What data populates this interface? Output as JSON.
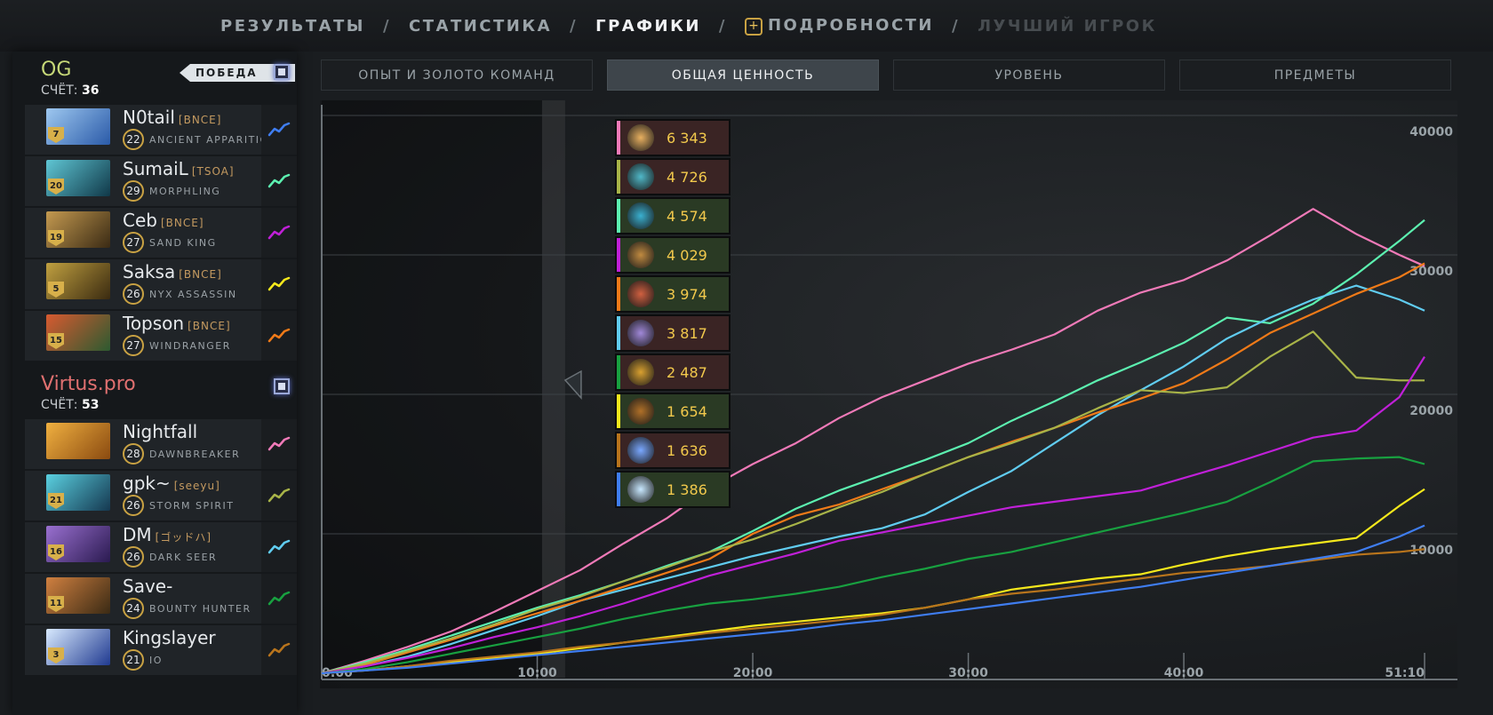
{
  "nav": {
    "tabs": [
      "РЕЗУЛЬТАТЫ",
      "СТАТИСТИКА",
      "ГРАФИКИ",
      "ПОДРОБНОСТИ",
      "ЛУЧШИЙ ИГРОК"
    ],
    "active_tab": "ГРАФИКИ",
    "separator": "/"
  },
  "teams": [
    {
      "name": "OG",
      "name_color": "#c6d878",
      "score_label": "СЧЁТ:",
      "score": "36",
      "badge": "ПОБЕДА",
      "players": [
        {
          "name": "N0tail",
          "tag": "[BNCE]",
          "level": "22",
          "hero": "ANCIENT APPARITION",
          "portrait_level": "7",
          "trend_color": "#3f7df0",
          "portrait_colors": [
            "#9ec8f0",
            "#2a5aa8"
          ]
        },
        {
          "name": "SumaiL",
          "tag": "[TSOA]",
          "level": "29",
          "hero": "MORPHLING",
          "portrait_level": "20",
          "trend_color": "#5cf0b0",
          "portrait_colors": [
            "#5fc6d4",
            "#103848"
          ]
        },
        {
          "name": "Ceb",
          "tag": "[BNCE]",
          "level": "27",
          "hero": "SAND KING",
          "portrait_level": "19",
          "trend_color": "#c020d8",
          "portrait_colors": [
            "#c49a50",
            "#3a2a14"
          ]
        },
        {
          "name": "Saksa",
          "tag": "[BNCE]",
          "level": "26",
          "hero": "NYX ASSASSIN",
          "portrait_level": "5",
          "trend_color": "#f4e81c",
          "portrait_colors": [
            "#c0a040",
            "#3a2a10"
          ]
        },
        {
          "name": "Topson",
          "tag": "[BNCE]",
          "level": "27",
          "hero": "WINDRANGER",
          "portrait_level": "15",
          "trend_color": "#f07a18",
          "portrait_colors": [
            "#d85a30",
            "#2c5a30"
          ]
        }
      ]
    },
    {
      "name": "Virtus.pro",
      "name_color": "#e07070",
      "score_label": "СЧЁТ:",
      "score": "53",
      "players": [
        {
          "name": "Nightfall",
          "tag": "",
          "level": "28",
          "hero": "DAWNBREAKER",
          "portrait_level": "",
          "trend_color": "#f07ab8",
          "portrait_colors": [
            "#f0b040",
            "#8a4a10"
          ]
        },
        {
          "name": "gpk~",
          "tag": "[seeyu]",
          "level": "26",
          "hero": "STORM SPIRIT",
          "portrait_level": "21",
          "trend_color": "#a8b448",
          "portrait_colors": [
            "#5ad0e0",
            "#153850"
          ]
        },
        {
          "name": "DM",
          "tag": "[ゴッドハ]",
          "level": "26",
          "hero": "DARK SEER",
          "portrait_level": "16",
          "trend_color": "#60ccf0",
          "portrait_colors": [
            "#9a70d0",
            "#2a1a50"
          ]
        },
        {
          "name": "Save-",
          "tag": "",
          "level": "24",
          "hero": "BOUNTY HUNTER",
          "portrait_level": "11",
          "trend_color": "#18a040",
          "portrait_colors": [
            "#d08040",
            "#3a2a14"
          ]
        },
        {
          "name": "Kingslayer",
          "tag": "",
          "level": "21",
          "hero": "IO",
          "portrait_level": "3",
          "trend_color": "#b8741c",
          "portrait_colors": [
            "#d8eaff",
            "#203a90"
          ]
        }
      ]
    }
  ],
  "subtabs": [
    "ОПЫТ И ЗОЛОТО КОМАНД",
    "ОБЩАЯ ЦЕННОСТЬ",
    "УРОВЕНЬ",
    "ПРЕДМЕТЫ"
  ],
  "active_subtab": "ОБЩАЯ ЦЕННОСТЬ",
  "tooltip": [
    {
      "value": "6 343",
      "color": "#f07ab8",
      "bg": "#3a2424",
      "hero_color": "#e8b060"
    },
    {
      "value": "4 726",
      "color": "#a8b448",
      "bg": "#3a2424",
      "hero_color": "#50b8c8"
    },
    {
      "value": "4 574",
      "color": "#5cf0b0",
      "bg": "#2a3a24",
      "hero_color": "#3ab0d0"
    },
    {
      "value": "4 029",
      "color": "#c020d8",
      "bg": "#2a3a24",
      "hero_color": "#c08a40"
    },
    {
      "value": "3 974",
      "color": "#f07a18",
      "bg": "#2a3a24",
      "hero_color": "#d06040"
    },
    {
      "value": "3 817",
      "color": "#60ccf0",
      "bg": "#3a2424",
      "hero_color": "#a088d8"
    },
    {
      "value": "2 487",
      "color": "#18a040",
      "bg": "#3a2424",
      "hero_color": "#d8a030"
    },
    {
      "value": "1 654",
      "color": "#f4e81c",
      "bg": "#2a3a24",
      "hero_color": "#b07028"
    },
    {
      "value": "1 636",
      "color": "#b8741c",
      "bg": "#3a2424",
      "hero_color": "#7aa8ff"
    },
    {
      "value": "1 386",
      "color": "#3f7df0",
      "bg": "#2a3a24",
      "hero_color": "#c8e8ff"
    }
  ],
  "chart_data": {
    "type": "line",
    "title": "",
    "xlabel": "",
    "ylabel": "",
    "x_ticks": [
      "0:00",
      "10:00",
      "20:00",
      "30:00",
      "40:00",
      "51:10"
    ],
    "x_tick_minutes": [
      0,
      10,
      20,
      30,
      40,
      51.17
    ],
    "y_ticks": [
      "10000",
      "20000",
      "30000",
      "40000"
    ],
    "y_tick_values": [
      10000,
      20000,
      30000,
      40000
    ],
    "xlim": [
      0,
      51.17
    ],
    "ylim": [
      0,
      40000
    ],
    "x": [
      0,
      2,
      4,
      6,
      8,
      10,
      12,
      14,
      16,
      18,
      20,
      22,
      24,
      26,
      28,
      30,
      32,
      34,
      36,
      38,
      40,
      42,
      44,
      46,
      48,
      50,
      51.17
    ],
    "hover_minute": 10.8,
    "series": [
      {
        "hero": "Dawnbreaker",
        "color": "#f07ab8",
        "values": [
          0,
          900,
          1900,
          3000,
          4400,
          5900,
          7400,
          9300,
          11100,
          13300,
          15000,
          16500,
          18300,
          19800,
          21000,
          22200,
          23200,
          24300,
          26000,
          27300,
          28200,
          29600,
          31400,
          33300,
          31500,
          30000,
          29200
        ]
      },
      {
        "hero": "Morphling",
        "color": "#5cf0b0",
        "values": [
          0,
          800,
          1700,
          2700,
          3700,
          4700,
          5600,
          6600,
          7700,
          8700,
          10200,
          11800,
          13100,
          14200,
          15300,
          16500,
          18100,
          19500,
          21000,
          22300,
          23700,
          25500,
          25100,
          26500,
          28600,
          31000,
          32500
        ]
      },
      {
        "hero": "Dark Seer",
        "color": "#60ccf0",
        "values": [
          0,
          500,
          1200,
          2100,
          3100,
          4100,
          5200,
          6000,
          6800,
          7600,
          8400,
          9100,
          9800,
          10400,
          11400,
          13000,
          14500,
          16500,
          18500,
          20300,
          22000,
          24000,
          25500,
          26800,
          27800,
          26800,
          26000
        ]
      },
      {
        "hero": "Windranger",
        "color": "#f07a18",
        "values": [
          0,
          600,
          1500,
          2400,
          3400,
          4300,
          5200,
          6200,
          7200,
          8200,
          10000,
          11300,
          12100,
          13200,
          14300,
          15500,
          16600,
          17600,
          18700,
          19700,
          20800,
          22500,
          24400,
          25800,
          27200,
          28400,
          29400
        ]
      },
      {
        "hero": "Storm Spirit",
        "color": "#a8b448",
        "values": [
          0,
          700,
          1600,
          2500,
          3500,
          4600,
          5500,
          6600,
          7600,
          8700,
          9600,
          10700,
          11900,
          13000,
          14300,
          15500,
          16500,
          17600,
          19000,
          20300,
          20100,
          20500,
          22700,
          24500,
          21200,
          21000,
          21000
        ]
      },
      {
        "hero": "Sand King",
        "color": "#c020d8",
        "values": [
          0,
          500,
          1100,
          1800,
          2600,
          3300,
          4100,
          5000,
          6000,
          7000,
          7800,
          8600,
          9500,
          10100,
          10700,
          11300,
          11900,
          12300,
          12700,
          13100,
          14000,
          14900,
          15900,
          16900,
          17400,
          19800,
          22700
        ]
      },
      {
        "hero": "Bounty Hunter",
        "color": "#18a040",
        "values": [
          0,
          300,
          800,
          1400,
          2000,
          2600,
          3200,
          3900,
          4500,
          5000,
          5300,
          5700,
          6200,
          6900,
          7500,
          8200,
          8700,
          9400,
          10100,
          10800,
          11500,
          12300,
          13700,
          15200,
          15400,
          15500,
          15000
        ]
      },
      {
        "hero": "Nyx Assassin",
        "color": "#f4e81c",
        "values": [
          0,
          200,
          500,
          800,
          1100,
          1400,
          1800,
          2200,
          2600,
          3000,
          3400,
          3700,
          4000,
          4300,
          4700,
          5300,
          6000,
          6400,
          6800,
          7100,
          7800,
          8400,
          8900,
          9300,
          9700,
          12000,
          13200
        ]
      },
      {
        "hero": "IO",
        "color": "#b8741c",
        "values": [
          0,
          200,
          500,
          900,
          1200,
          1500,
          1900,
          2200,
          2500,
          2900,
          3200,
          3500,
          3800,
          4200,
          4700,
          5300,
          5700,
          6000,
          6400,
          6800,
          7200,
          7400,
          7700,
          8100,
          8500,
          8700,
          8900
        ]
      },
      {
        "hero": "Ancient Apparition",
        "color": "#3f7df0",
        "values": [
          0,
          200,
          400,
          700,
          1000,
          1300,
          1600,
          1900,
          2200,
          2500,
          2800,
          3100,
          3500,
          3800,
          4200,
          4600,
          5000,
          5400,
          5800,
          6200,
          6700,
          7200,
          7700,
          8200,
          8700,
          9800,
          10600
        ]
      }
    ]
  }
}
